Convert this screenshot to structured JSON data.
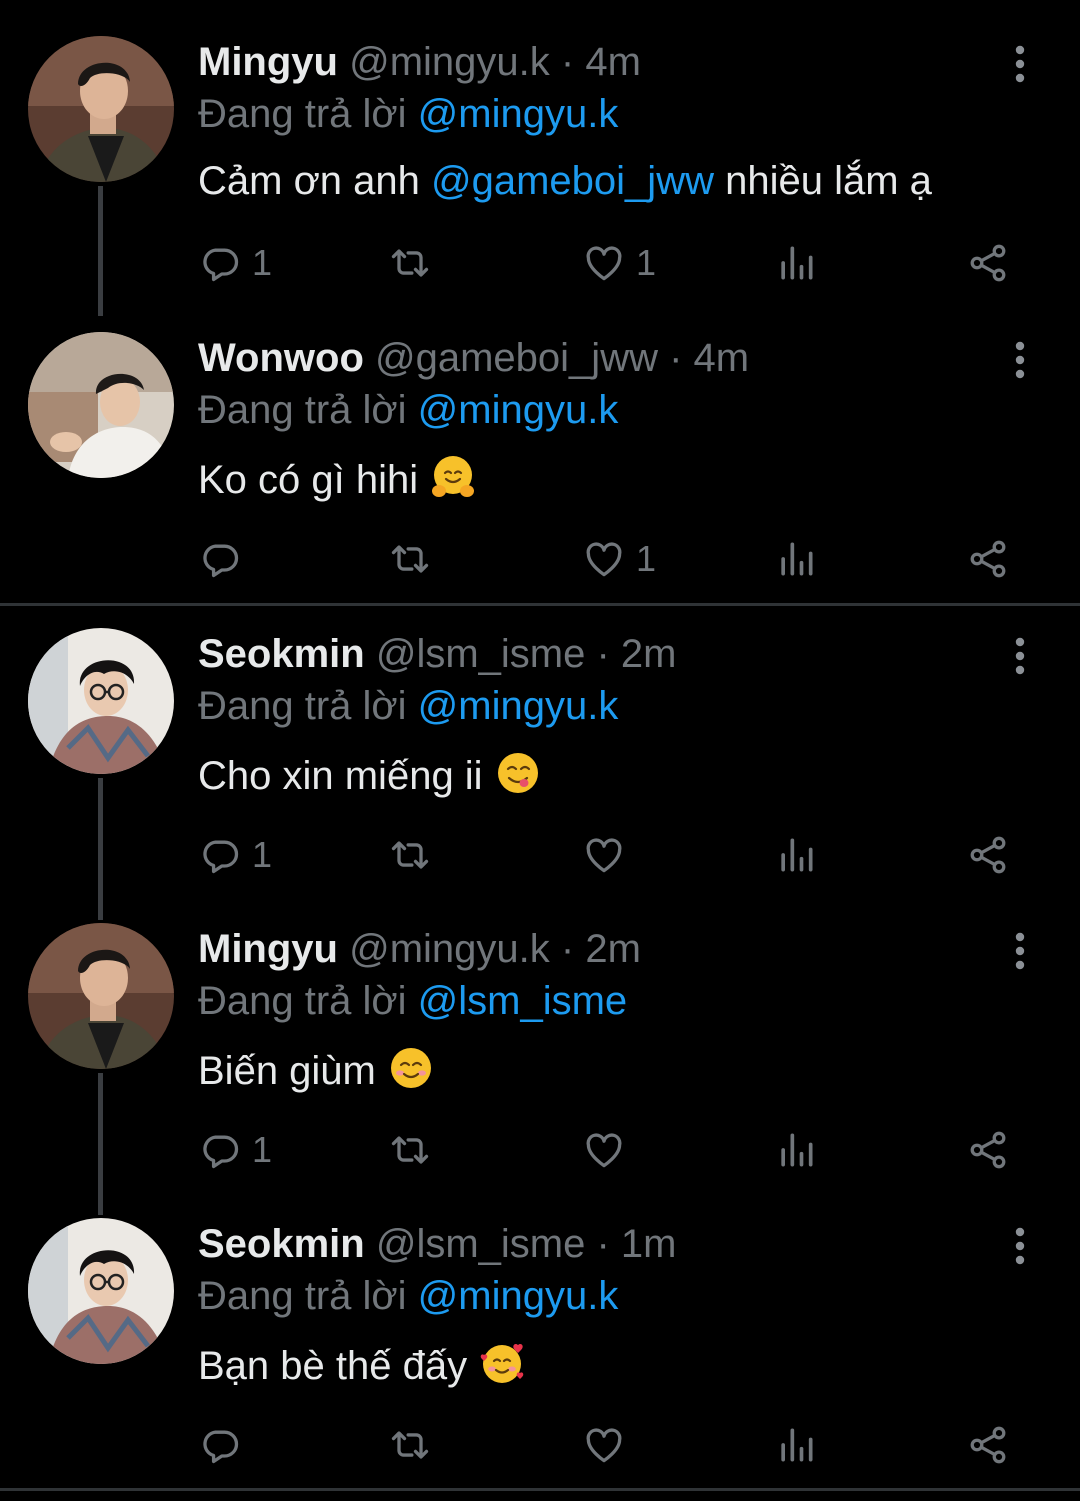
{
  "colors": {
    "background": "#000000",
    "primary_text": "#e7e9ea",
    "secondary_text": "#71767b",
    "accent": "#1d9bf0",
    "divider": "#2f3336"
  },
  "tweets": [
    {
      "name": "Mingyu",
      "handle": "@mingyu.k",
      "sep": " · ",
      "time": "4m",
      "reply_label": "Đang trả lời ",
      "reply_to": "@mingyu.k",
      "body_before": "Cảm ơn anh ",
      "body_mention": "@gameboi_jww",
      "body_after": " nhiều lắm ạ",
      "emoji": "",
      "reply_count": "1",
      "retweet_count": "",
      "like_count": "1",
      "avatar": "mingyu"
    },
    {
      "name": "Wonwoo",
      "handle": "@gameboi_jww",
      "sep": " · ",
      "time": "4m",
      "reply_label": "Đang trả lời ",
      "reply_to": "@mingyu.k",
      "body_before": "Ko có gì hihi ",
      "body_mention": "",
      "body_after": "",
      "emoji": "hugging-face",
      "reply_count": "",
      "retweet_count": "",
      "like_count": "1",
      "avatar": "wonwoo"
    },
    {
      "name": "Seokmin",
      "handle": "@lsm_isme",
      "sep": " · ",
      "time": "2m",
      "reply_label": "Đang trả lời ",
      "reply_to": "@mingyu.k",
      "body_before": "Cho xin miếng ii ",
      "body_mention": "",
      "body_after": "",
      "emoji": "face-savoring-food",
      "reply_count": "1",
      "retweet_count": "",
      "like_count": "",
      "avatar": "seokmin"
    },
    {
      "name": "Mingyu",
      "handle": "@mingyu.k",
      "sep": " · ",
      "time": "2m",
      "reply_label": "Đang trả lời ",
      "reply_to": "@lsm_isme",
      "body_before": "Biến giùm ",
      "body_mention": "",
      "body_after": "",
      "emoji": "smiling-face",
      "reply_count": "1",
      "retweet_count": "",
      "like_count": "",
      "avatar": "mingyu"
    },
    {
      "name": "Seokmin",
      "handle": "@lsm_isme",
      "sep": " · ",
      "time": "1m",
      "reply_label": "Đang trả lời ",
      "reply_to": "@mingyu.k",
      "body_before": "Bạn bè thế đấy ",
      "body_mention": "",
      "body_after": "",
      "emoji": "smiling-face-with-hearts",
      "reply_count": "",
      "retweet_count": "",
      "like_count": "",
      "avatar": "seokmin"
    }
  ],
  "icons": {
    "reply": "reply-icon",
    "retweet": "retweet-icon",
    "like": "heart-icon",
    "views": "views-icon",
    "share": "share-icon",
    "more": "more-icon"
  }
}
